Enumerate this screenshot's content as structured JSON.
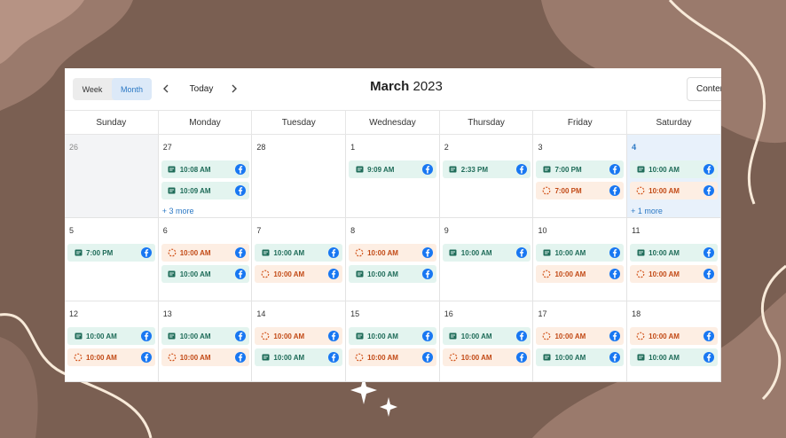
{
  "toolbar": {
    "view_week": "Week",
    "view_month": "Month",
    "today": "Today",
    "title_month": "March",
    "title_year": "2023",
    "content_btn": "Content"
  },
  "weekdays": [
    "Sunday",
    "Monday",
    "Tuesday",
    "Wednesday",
    "Thursday",
    "Friday",
    "Saturday"
  ],
  "colors": {
    "published": "#e3f4ef",
    "scheduled": "#fdeee3",
    "accent": "#2b78c4",
    "today": "#e8f1fb"
  },
  "icons": {
    "published": "post-card-icon",
    "scheduled": "dashed-clock-icon",
    "network": "facebook-icon",
    "prev": "chevron-left-icon",
    "next": "chevron-right-icon"
  },
  "weeks": [
    {
      "days": [
        {
          "num": "26",
          "other": true,
          "events": []
        },
        {
          "num": "27",
          "events": [
            {
              "time": "10:08 AM",
              "kind": "published"
            },
            {
              "time": "10:09 AM",
              "kind": "published"
            }
          ],
          "more": "+ 3 more"
        },
        {
          "num": "28",
          "events": []
        },
        {
          "num": "1",
          "events": [
            {
              "time": "9:09 AM",
              "kind": "published"
            }
          ]
        },
        {
          "num": "2",
          "events": [
            {
              "time": "2:33 PM",
              "kind": "published"
            }
          ]
        },
        {
          "num": "3",
          "events": [
            {
              "time": "7:00 PM",
              "kind": "published"
            },
            {
              "time": "7:00 PM",
              "kind": "scheduled"
            }
          ]
        },
        {
          "num": "4",
          "today": true,
          "events": [
            {
              "time": "10:00 AM",
              "kind": "published"
            },
            {
              "time": "10:00 AM",
              "kind": "scheduled"
            }
          ],
          "more": "+ 1 more"
        }
      ]
    },
    {
      "days": [
        {
          "num": "5",
          "events": [
            {
              "time": "7:00 PM",
              "kind": "published"
            }
          ]
        },
        {
          "num": "6",
          "events": [
            {
              "time": "10:00 AM",
              "kind": "scheduled"
            },
            {
              "time": "10:00 AM",
              "kind": "published"
            }
          ]
        },
        {
          "num": "7",
          "events": [
            {
              "time": "10:00 AM",
              "kind": "published"
            },
            {
              "time": "10:00 AM",
              "kind": "scheduled"
            }
          ]
        },
        {
          "num": "8",
          "events": [
            {
              "time": "10:00 AM",
              "kind": "scheduled"
            },
            {
              "time": "10:00 AM",
              "kind": "published"
            }
          ]
        },
        {
          "num": "9",
          "events": [
            {
              "time": "10:00 AM",
              "kind": "published"
            }
          ]
        },
        {
          "num": "10",
          "events": [
            {
              "time": "10:00 AM",
              "kind": "published"
            },
            {
              "time": "10:00 AM",
              "kind": "scheduled"
            }
          ]
        },
        {
          "num": "11",
          "events": [
            {
              "time": "10:00 AM",
              "kind": "published"
            },
            {
              "time": "10:00 AM",
              "kind": "scheduled"
            }
          ]
        }
      ]
    },
    {
      "days": [
        {
          "num": "12",
          "events": [
            {
              "time": "10:00 AM",
              "kind": "published"
            },
            {
              "time": "10:00 AM",
              "kind": "scheduled"
            }
          ]
        },
        {
          "num": "13",
          "events": [
            {
              "time": "10:00 AM",
              "kind": "published"
            },
            {
              "time": "10:00 AM",
              "kind": "scheduled"
            }
          ]
        },
        {
          "num": "14",
          "events": [
            {
              "time": "10:00 AM",
              "kind": "scheduled"
            },
            {
              "time": "10:00 AM",
              "kind": "published"
            }
          ]
        },
        {
          "num": "15",
          "events": [
            {
              "time": "10:00 AM",
              "kind": "published"
            },
            {
              "time": "10:00 AM",
              "kind": "scheduled"
            }
          ]
        },
        {
          "num": "16",
          "events": [
            {
              "time": "10:00 AM",
              "kind": "published"
            },
            {
              "time": "10:00 AM",
              "kind": "scheduled"
            }
          ]
        },
        {
          "num": "17",
          "events": [
            {
              "time": "10:00 AM",
              "kind": "scheduled"
            },
            {
              "time": "10:00 AM",
              "kind": "published"
            }
          ]
        },
        {
          "num": "18",
          "events": [
            {
              "time": "10:00 AM",
              "kind": "scheduled"
            },
            {
              "time": "10:00 AM",
              "kind": "published"
            }
          ]
        }
      ]
    }
  ]
}
